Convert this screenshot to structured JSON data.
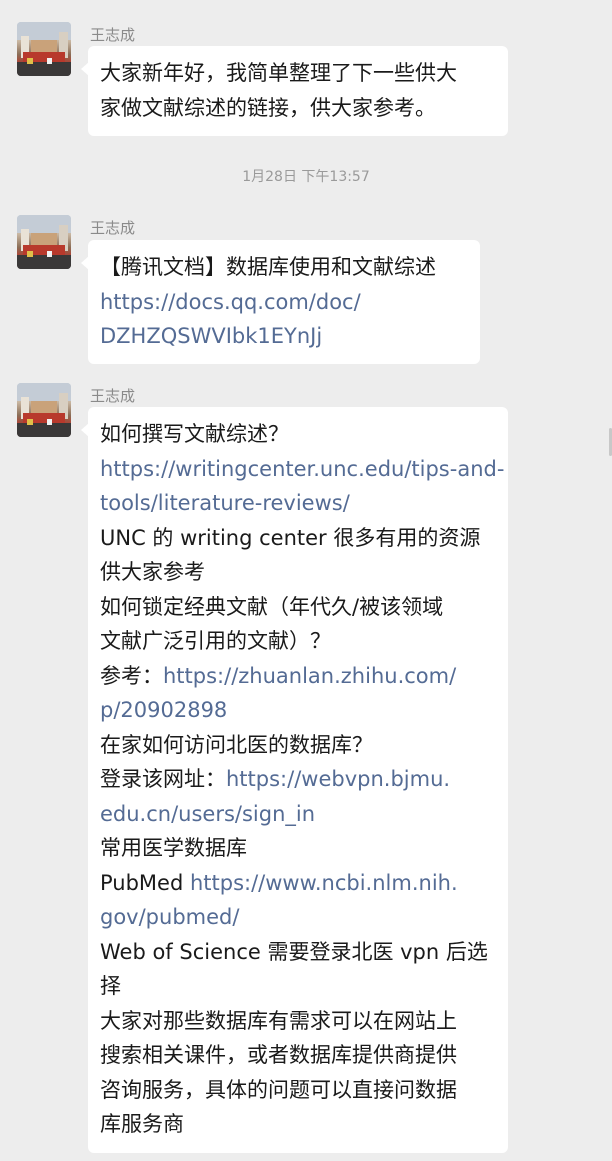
{
  "messages": [
    {
      "sender": "王志成",
      "lines": [
        {
          "text": "大家新年好，我简单整理了下一些供大",
          "link": false
        },
        {
          "text": "家做文献综述的链接，供大家参考。",
          "link": false
        }
      ]
    },
    {
      "sender": "王志成",
      "lines": [
        {
          "text": "【腾讯文档】数据库使用和文献综述",
          "link": false
        },
        {
          "text": "https://docs.qq.com/doc/",
          "link": true
        },
        {
          "text": "DZHZQSWVIbk1EYnJj",
          "link": true
        }
      ]
    },
    {
      "sender": "王志成",
      "lines": [
        {
          "segments": [
            {
              "text": "如何撰写文献综述？",
              "link": false
            }
          ]
        },
        {
          "segments": [
            {
              "text": "https://writingcenter.unc.edu/tips-and-",
              "link": true
            }
          ]
        },
        {
          "segments": [
            {
              "text": "tools/literature-reviews/",
              "link": true
            }
          ]
        },
        {
          "segments": [
            {
              "text": "UNC 的 writing center 很多有用的资源",
              "link": false
            }
          ]
        },
        {
          "segments": [
            {
              "text": "供大家参考",
              "link": false
            }
          ]
        },
        {
          "segments": [
            {
              "text": "如何锁定经典文献（年代久/被该领域",
              "link": false
            }
          ]
        },
        {
          "segments": [
            {
              "text": "文献广泛引用的文献）？",
              "link": false
            }
          ]
        },
        {
          "segments": [
            {
              "text": "参考：",
              "link": false
            },
            {
              "text": "https://zhuanlan.zhihu.com/",
              "link": true
            }
          ]
        },
        {
          "segments": [
            {
              "text": "p/20902898",
              "link": true
            }
          ]
        },
        {
          "segments": [
            {
              "text": "在家如何访问北医的数据库？",
              "link": false
            }
          ]
        },
        {
          "segments": [
            {
              "text": "登录该网址：",
              "link": false
            },
            {
              "text": "https://webvpn.bjmu.",
              "link": true
            }
          ]
        },
        {
          "segments": [
            {
              "text": "edu.cn/users/sign_in",
              "link": true
            }
          ]
        },
        {
          "segments": [
            {
              "text": "常用医学数据库",
              "link": false
            }
          ]
        },
        {
          "segments": [
            {
              "text": "PubMed ",
              "link": false
            },
            {
              "text": "https://www.ncbi.nlm.nih.",
              "link": true
            }
          ]
        },
        {
          "segments": [
            {
              "text": "gov/pubmed/",
              "link": true
            }
          ]
        },
        {
          "segments": [
            {
              "text": "Web of Science 需要登录北医 vpn 后选",
              "link": false
            }
          ]
        },
        {
          "segments": [
            {
              "text": "择",
              "link": false
            }
          ]
        },
        {
          "segments": [
            {
              "text": "大家对那些数据库有需求可以在网站上",
              "link": false
            }
          ]
        },
        {
          "segments": [
            {
              "text": "搜索相关课件，或者数据库提供商提供",
              "link": false
            }
          ]
        },
        {
          "segments": [
            {
              "text": "咨询服务，具体的问题可以直接问数据",
              "link": false
            }
          ]
        },
        {
          "segments": [
            {
              "text": "库服务商",
              "link": false
            }
          ]
        }
      ]
    }
  ],
  "timestamp": "1月28日 下午13:57",
  "colors": {
    "background": "#ededed",
    "bubble": "#ffffff",
    "link": "#546b94",
    "meta_text": "#8a8a8a"
  },
  "icons": {
    "avatar": "avatar-photo-icon"
  }
}
